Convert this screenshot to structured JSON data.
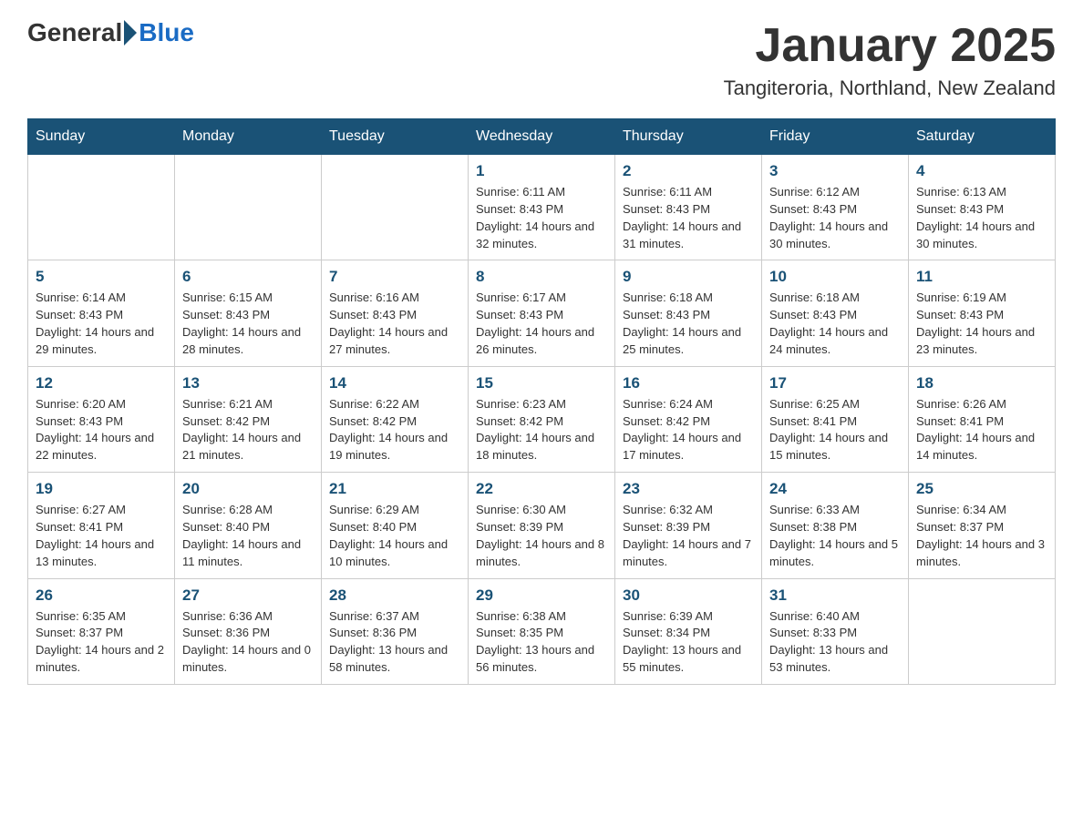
{
  "header": {
    "logo_general": "General",
    "logo_blue": "Blue",
    "month_title": "January 2025",
    "location": "Tangiteroria, Northland, New Zealand"
  },
  "days_of_week": [
    "Sunday",
    "Monday",
    "Tuesday",
    "Wednesday",
    "Thursday",
    "Friday",
    "Saturday"
  ],
  "weeks": [
    [
      {
        "day": "",
        "info": ""
      },
      {
        "day": "",
        "info": ""
      },
      {
        "day": "",
        "info": ""
      },
      {
        "day": "1",
        "info": "Sunrise: 6:11 AM\nSunset: 8:43 PM\nDaylight: 14 hours and 32 minutes."
      },
      {
        "day": "2",
        "info": "Sunrise: 6:11 AM\nSunset: 8:43 PM\nDaylight: 14 hours and 31 minutes."
      },
      {
        "day": "3",
        "info": "Sunrise: 6:12 AM\nSunset: 8:43 PM\nDaylight: 14 hours and 30 minutes."
      },
      {
        "day": "4",
        "info": "Sunrise: 6:13 AM\nSunset: 8:43 PM\nDaylight: 14 hours and 30 minutes."
      }
    ],
    [
      {
        "day": "5",
        "info": "Sunrise: 6:14 AM\nSunset: 8:43 PM\nDaylight: 14 hours and 29 minutes."
      },
      {
        "day": "6",
        "info": "Sunrise: 6:15 AM\nSunset: 8:43 PM\nDaylight: 14 hours and 28 minutes."
      },
      {
        "day": "7",
        "info": "Sunrise: 6:16 AM\nSunset: 8:43 PM\nDaylight: 14 hours and 27 minutes."
      },
      {
        "day": "8",
        "info": "Sunrise: 6:17 AM\nSunset: 8:43 PM\nDaylight: 14 hours and 26 minutes."
      },
      {
        "day": "9",
        "info": "Sunrise: 6:18 AM\nSunset: 8:43 PM\nDaylight: 14 hours and 25 minutes."
      },
      {
        "day": "10",
        "info": "Sunrise: 6:18 AM\nSunset: 8:43 PM\nDaylight: 14 hours and 24 minutes."
      },
      {
        "day": "11",
        "info": "Sunrise: 6:19 AM\nSunset: 8:43 PM\nDaylight: 14 hours and 23 minutes."
      }
    ],
    [
      {
        "day": "12",
        "info": "Sunrise: 6:20 AM\nSunset: 8:43 PM\nDaylight: 14 hours and 22 minutes."
      },
      {
        "day": "13",
        "info": "Sunrise: 6:21 AM\nSunset: 8:42 PM\nDaylight: 14 hours and 21 minutes."
      },
      {
        "day": "14",
        "info": "Sunrise: 6:22 AM\nSunset: 8:42 PM\nDaylight: 14 hours and 19 minutes."
      },
      {
        "day": "15",
        "info": "Sunrise: 6:23 AM\nSunset: 8:42 PM\nDaylight: 14 hours and 18 minutes."
      },
      {
        "day": "16",
        "info": "Sunrise: 6:24 AM\nSunset: 8:42 PM\nDaylight: 14 hours and 17 minutes."
      },
      {
        "day": "17",
        "info": "Sunrise: 6:25 AM\nSunset: 8:41 PM\nDaylight: 14 hours and 15 minutes."
      },
      {
        "day": "18",
        "info": "Sunrise: 6:26 AM\nSunset: 8:41 PM\nDaylight: 14 hours and 14 minutes."
      }
    ],
    [
      {
        "day": "19",
        "info": "Sunrise: 6:27 AM\nSunset: 8:41 PM\nDaylight: 14 hours and 13 minutes."
      },
      {
        "day": "20",
        "info": "Sunrise: 6:28 AM\nSunset: 8:40 PM\nDaylight: 14 hours and 11 minutes."
      },
      {
        "day": "21",
        "info": "Sunrise: 6:29 AM\nSunset: 8:40 PM\nDaylight: 14 hours and 10 minutes."
      },
      {
        "day": "22",
        "info": "Sunrise: 6:30 AM\nSunset: 8:39 PM\nDaylight: 14 hours and 8 minutes."
      },
      {
        "day": "23",
        "info": "Sunrise: 6:32 AM\nSunset: 8:39 PM\nDaylight: 14 hours and 7 minutes."
      },
      {
        "day": "24",
        "info": "Sunrise: 6:33 AM\nSunset: 8:38 PM\nDaylight: 14 hours and 5 minutes."
      },
      {
        "day": "25",
        "info": "Sunrise: 6:34 AM\nSunset: 8:37 PM\nDaylight: 14 hours and 3 minutes."
      }
    ],
    [
      {
        "day": "26",
        "info": "Sunrise: 6:35 AM\nSunset: 8:37 PM\nDaylight: 14 hours and 2 minutes."
      },
      {
        "day": "27",
        "info": "Sunrise: 6:36 AM\nSunset: 8:36 PM\nDaylight: 14 hours and 0 minutes."
      },
      {
        "day": "28",
        "info": "Sunrise: 6:37 AM\nSunset: 8:36 PM\nDaylight: 13 hours and 58 minutes."
      },
      {
        "day": "29",
        "info": "Sunrise: 6:38 AM\nSunset: 8:35 PM\nDaylight: 13 hours and 56 minutes."
      },
      {
        "day": "30",
        "info": "Sunrise: 6:39 AM\nSunset: 8:34 PM\nDaylight: 13 hours and 55 minutes."
      },
      {
        "day": "31",
        "info": "Sunrise: 6:40 AM\nSunset: 8:33 PM\nDaylight: 13 hours and 53 minutes."
      },
      {
        "day": "",
        "info": ""
      }
    ]
  ]
}
